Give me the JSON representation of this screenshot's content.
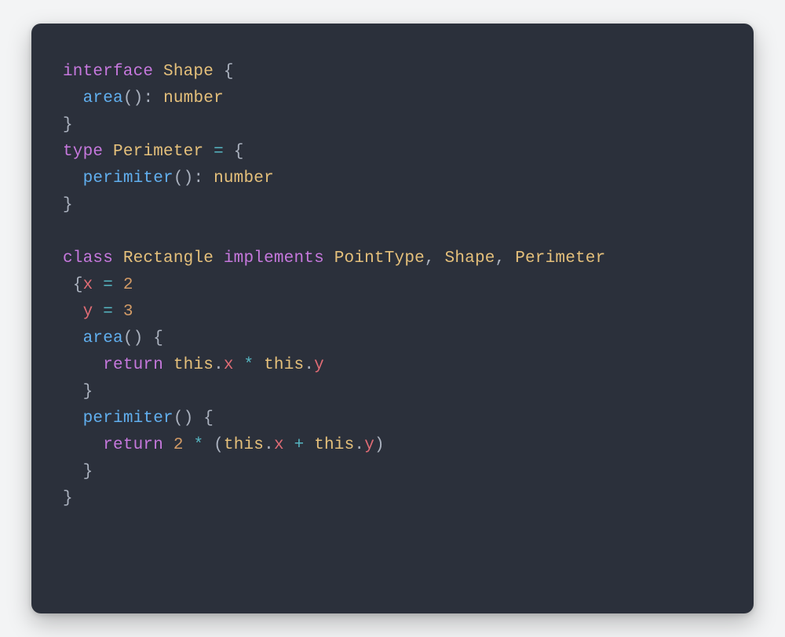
{
  "code": {
    "kw_interface": "interface",
    "type_shape": "Shape",
    "brace_open": "{",
    "brace_close": "}",
    "fn_area": "area",
    "paren_pair": "()",
    "colon": ":",
    "type_number": "number",
    "kw_type": "type",
    "type_perimeter": "Perimeter",
    "op_assign": "=",
    "fn_perimiter": "perimiter",
    "kw_class": "class",
    "type_rectangle": "Rectangle",
    "kw_implements": "implements",
    "type_pointtype": "PointType",
    "comma": ",",
    "prop_x": "x",
    "val_2": "2",
    "prop_y": "y",
    "val_3": "3",
    "kw_return": "return",
    "kw_this": "this",
    "dot": ".",
    "op_mul": "*",
    "op_plus": "+",
    "paren_open": "(",
    "paren_close": ")"
  }
}
